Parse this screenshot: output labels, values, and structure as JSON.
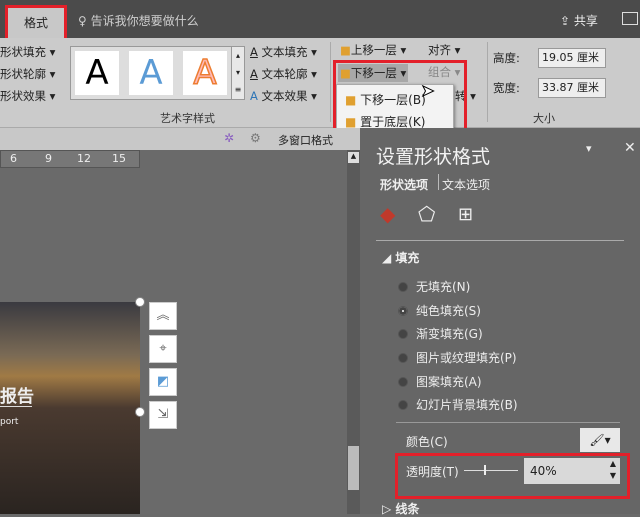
{
  "titlebar": {
    "tab": "格式",
    "search": "告诉我你想要做什么",
    "share": "共享"
  },
  "ribbon": {
    "shape": [
      "形状填充 ▾",
      "形状轮廓 ▾",
      "形状效果 ▾"
    ],
    "wordart_samples": [
      "A",
      "A",
      "A"
    ],
    "text": [
      "文本填充 ▾",
      "文本轮廓 ▾",
      "文本效果 ▾"
    ],
    "wordart_label": "艺术字样式",
    "arrange": {
      "bring_forward": "上移一层 ▾",
      "send_backward": "下移一层 ▾",
      "align": "对齐 ▾",
      "group": "组合 ▾",
      "rotate": "转 ▾"
    },
    "size": {
      "height_label": "高度:",
      "height": "19.05 厘米",
      "width_label": "宽度:",
      "width": "33.87 厘米",
      "label": "大小"
    }
  },
  "menu": [
    "下移一层(B)",
    "置于底层(K)"
  ],
  "subbar": {
    "multi": "多窗口格式"
  },
  "ruler": [
    "6",
    "9",
    "12",
    "15"
  ],
  "slide": {
    "title": "报告",
    "sub": "port"
  },
  "pane": {
    "title": "设置形状格式",
    "tabs": [
      "形状选项",
      "文本选项"
    ],
    "section": "填充",
    "options": [
      "无填充(N)",
      "纯色填充(S)",
      "渐变填充(G)",
      "图片或纹理填充(P)",
      "图案填充(A)",
      "幻灯片背景填充(B)"
    ],
    "selected": 1,
    "color_label": "颜色(C)",
    "transparency_label": "透明度(T)",
    "transparency": "40%",
    "transparency_value": 40,
    "line_section": "线条"
  },
  "colors": {
    "accent": "#e3202a",
    "fill_icon": "#c0392b"
  }
}
